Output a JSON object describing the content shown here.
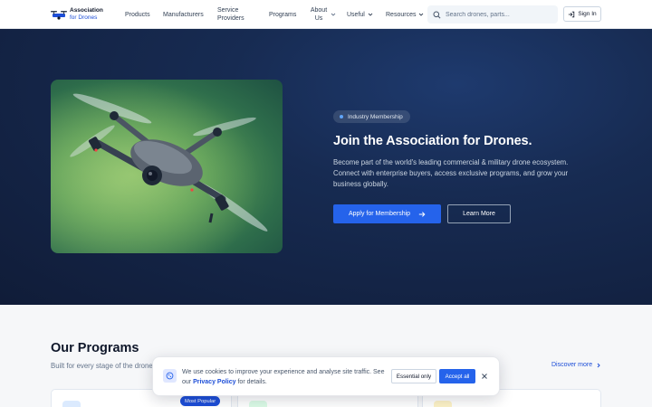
{
  "header": {
    "logo": {
      "line1": "Association",
      "line2": "for Drones"
    },
    "nav": [
      {
        "label": "Products",
        "dropdown": false
      },
      {
        "label": "Manufacturers",
        "dropdown": false
      },
      {
        "label": "Service Providers",
        "dropdown": false
      },
      {
        "label": "Programs",
        "dropdown": false
      },
      {
        "label": "About Us",
        "dropdown": true
      },
      {
        "label": "Useful",
        "dropdown": true
      },
      {
        "label": "Resources",
        "dropdown": true
      }
    ],
    "search_placeholder": "Search drones, parts...",
    "signin_label": "Sign In"
  },
  "hero": {
    "badge": "Industry Membership",
    "title": "Join the Association for Drones.",
    "description": "Become part of the world's leading commercial & military drone ecosystem. Connect with enterprise buyers, access exclusive programs, and grow your business globally.",
    "primary_button": "Apply for Membership",
    "secondary_button": "Learn More",
    "image_subject": "drone-in-flight"
  },
  "programs": {
    "title": "Our Programs",
    "subtitle": "Built for every stage of the drone",
    "discover_label": "Discover more",
    "popular_badge": "Most Popular"
  },
  "cookie": {
    "text_before": "We use cookies to improve your experience and analyse site traffic. See our ",
    "link_label": "Privacy Policy",
    "text_after": " for details.",
    "essential_label": "Essential only",
    "accept_label": "Accept all"
  },
  "colors": {
    "accent": "#2563eb",
    "hero_bg": "#142647",
    "link": "#1d4ed8"
  }
}
